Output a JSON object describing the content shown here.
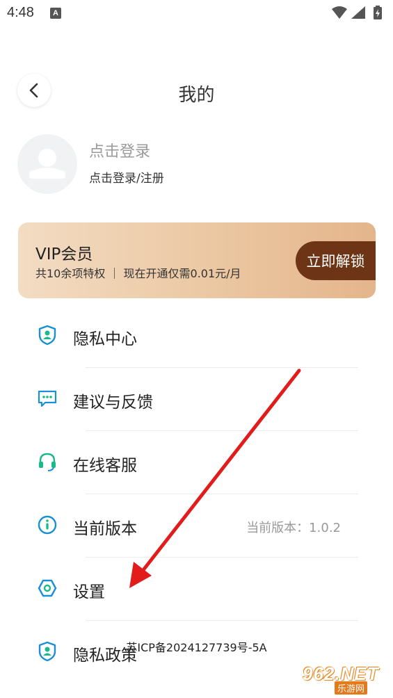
{
  "status_bar": {
    "time": "4:48",
    "notification_letter": "A",
    "icons": [
      "wifi-icon",
      "signal-icon",
      "battery-charging-icon"
    ]
  },
  "header": {
    "back_icon": "chevron-left-icon",
    "title": "我的"
  },
  "profile": {
    "avatar_icon": "user-placeholder-icon",
    "login_title": "点击登录",
    "login_subtitle": "点击登录/注册"
  },
  "vip": {
    "title": "VIP会员",
    "description": "共10余项特权 ｜ 现在开通仅需0.01元/月",
    "button_label": "立即解锁",
    "button_color": "#6d3415"
  },
  "menu": {
    "items": [
      {
        "label": "隐私中心",
        "icon": "shield-user-icon",
        "value": ""
      },
      {
        "label": "建议与反馈",
        "icon": "chat-bubble-icon",
        "value": ""
      },
      {
        "label": "在线客服",
        "icon": "headset-icon",
        "value": ""
      },
      {
        "label": "当前版本",
        "icon": "info-icon",
        "value": "当前版本：1.0.2"
      },
      {
        "label": "设置",
        "icon": "hexagon-settings-icon",
        "value": ""
      },
      {
        "label": "隐私政策",
        "icon": "shield-user-icon",
        "value": ""
      }
    ]
  },
  "footer": {
    "icp": "苏ICP备2024127739号-5A"
  },
  "watermark": {
    "number": "962.NET",
    "site": "乐游网"
  },
  "colors": {
    "icon_blue": "#1a8fd6",
    "icon_green": "#18b98a",
    "arrow_red": "#e21b1b"
  }
}
